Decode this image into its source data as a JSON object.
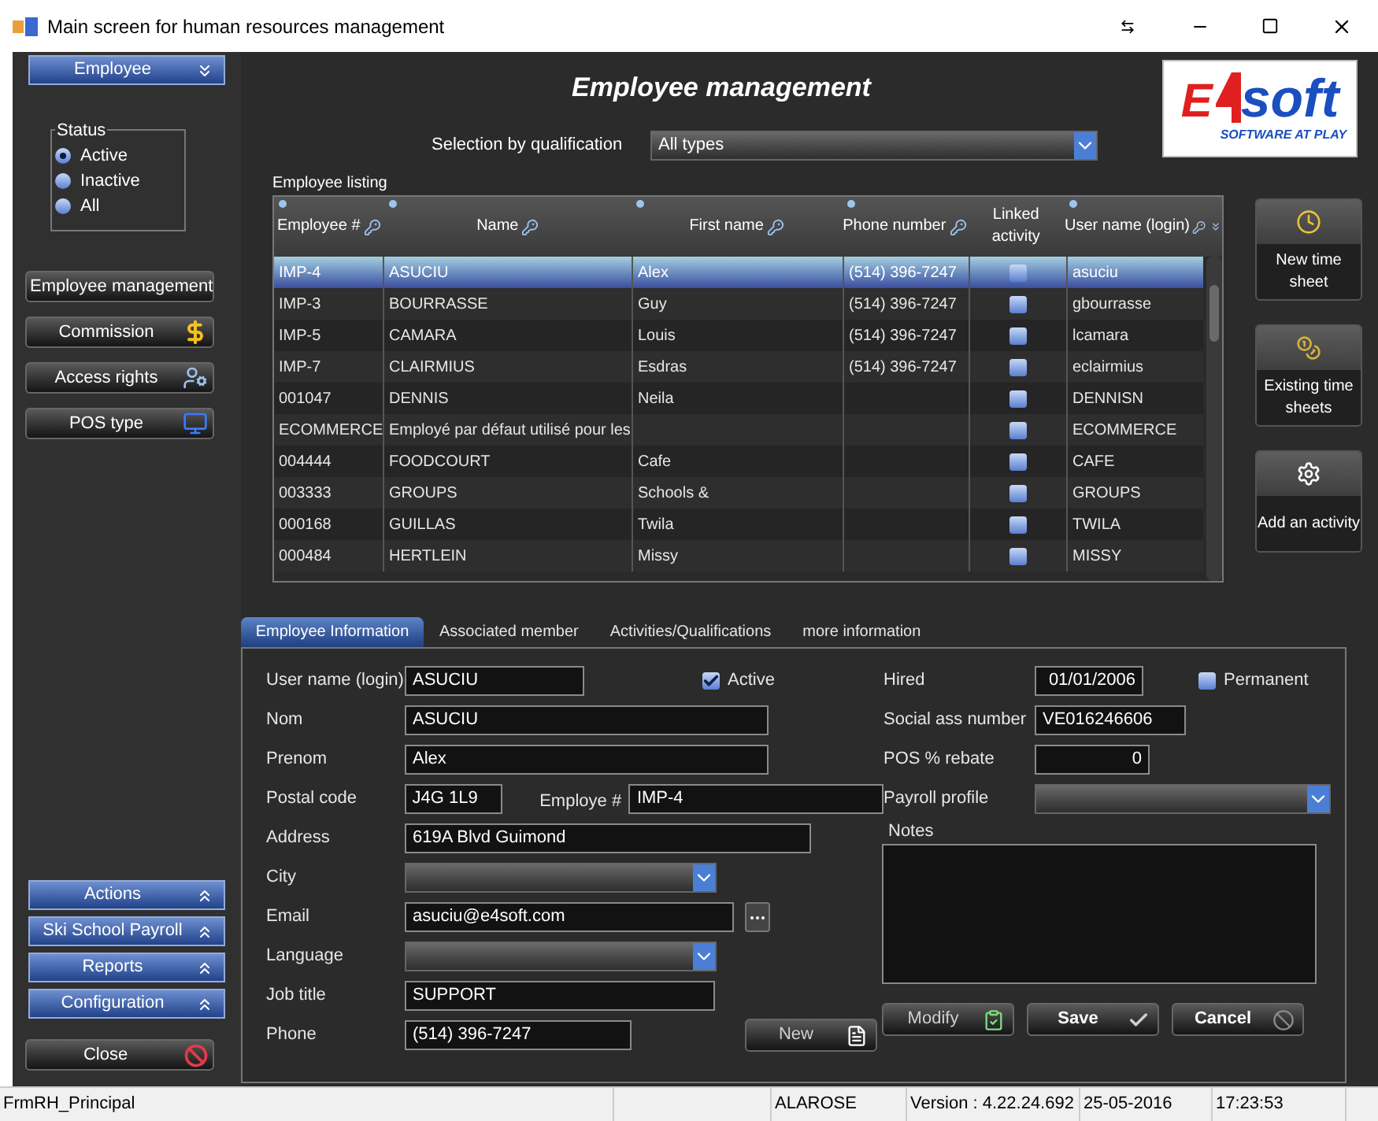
{
  "window": {
    "title": "Main screen for human resources management"
  },
  "sidebar": {
    "sections": [
      {
        "label": "Employee",
        "expanded": true
      },
      {
        "label": "Actions",
        "expanded": false
      },
      {
        "label": "Ski School Payroll",
        "expanded": false
      },
      {
        "label": "Reports",
        "expanded": false
      },
      {
        "label": "Configuration",
        "expanded": false
      }
    ],
    "status": {
      "label": "Status",
      "options": [
        {
          "label": "Active",
          "selected": true
        },
        {
          "label": "Inactive",
          "selected": false
        },
        {
          "label": "All",
          "selected": false
        }
      ]
    },
    "items": [
      {
        "label": "Employee management"
      },
      {
        "label": "Commission"
      },
      {
        "label": "Access rights"
      },
      {
        "label": "POS type"
      }
    ],
    "close_button": "Close"
  },
  "header": {
    "title": "Employee management",
    "logo": {
      "mark": "E",
      "name": "soft",
      "tagline": "SOFTWARE AT PLAY"
    }
  },
  "selection": {
    "label": "Selection by qualification",
    "value": "All types"
  },
  "listing": {
    "label": "Employee listing",
    "columns": [
      {
        "label": "Employee #",
        "filter": true
      },
      {
        "label": "Name",
        "filter": true
      },
      {
        "label": "First name",
        "filter": true
      },
      {
        "label": "Phone number",
        "filter": true
      },
      {
        "label": "Linked activity",
        "filter": false
      },
      {
        "label": "User name (login)",
        "filter": true
      }
    ],
    "rows": [
      {
        "cells": [
          "IMP-4",
          "ASUCIU",
          "Alex",
          "(514) 396-7247"
        ],
        "linked": false,
        "user": "asuciu",
        "selected": true
      },
      {
        "cells": [
          "IMP-3",
          "BOURRASSE",
          "Guy",
          "(514) 396-7247"
        ],
        "linked": false,
        "user": "gbourrasse",
        "selected": false
      },
      {
        "cells": [
          "IMP-5",
          "CAMARA",
          "Louis",
          "(514) 396-7247"
        ],
        "linked": false,
        "user": "lcamara",
        "selected": false
      },
      {
        "cells": [
          "IMP-7",
          "CLAIRMIUS",
          "Esdras",
          "(514) 396-7247"
        ],
        "linked": false,
        "user": "eclairmius",
        "selected": false
      },
      {
        "cells": [
          "001047",
          "DENNIS",
          "Neila",
          ""
        ],
        "linked": false,
        "user": "DENNISN",
        "selected": false
      },
      {
        "cells": [
          "ECOMMERCE",
          "Employé par défaut  utilisé pour les",
          "",
          ""
        ],
        "linked": false,
        "user": "ECOMMERCE",
        "selected": false
      },
      {
        "cells": [
          "004444",
          "FOODCOURT",
          "Cafe",
          ""
        ],
        "linked": false,
        "user": "CAFE",
        "selected": false
      },
      {
        "cells": [
          "003333",
          "GROUPS",
          "Schools &",
          ""
        ],
        "linked": false,
        "user": "GROUPS",
        "selected": false
      },
      {
        "cells": [
          "000168",
          "GUILLAS",
          "Twila",
          ""
        ],
        "linked": false,
        "user": "TWILA",
        "selected": false
      },
      {
        "cells": [
          "000484",
          "HERTLEIN",
          "Missy",
          ""
        ],
        "linked": false,
        "user": "MISSY",
        "selected": false
      }
    ]
  },
  "side_buttons": [
    {
      "label": "New time sheet"
    },
    {
      "label": "Existing time sheets"
    },
    {
      "label": "Add an activity"
    }
  ],
  "tabs": [
    {
      "label": "Employee Information",
      "selected": true
    },
    {
      "label": "Associated member",
      "selected": false
    },
    {
      "label": "Activities/Qualifications",
      "selected": false
    },
    {
      "label": "more information",
      "selected": false
    }
  ],
  "form": {
    "user_name": {
      "label": "User name (login)",
      "value": "ASUCIU"
    },
    "active": {
      "label": "Active",
      "checked": true
    },
    "nom": {
      "label": "Nom",
      "value": "ASUCIU"
    },
    "prenom": {
      "label": "Prenom",
      "value": "Alex"
    },
    "postal_code": {
      "label": "Postal code",
      "value": "J4G 1L9"
    },
    "employee_number": {
      "label": "Employe #",
      "value": "IMP-4"
    },
    "address": {
      "label": "Address",
      "value": "619A Blvd Guimond"
    },
    "city": {
      "label": "City"
    },
    "email": {
      "label": "Email",
      "value": "asuciu@e4soft.com"
    },
    "language": {
      "label": "Language"
    },
    "job_title": {
      "label": "Job title",
      "value": "SUPPORT"
    },
    "phone": {
      "label": "Phone",
      "value": "(514) 396-7247"
    },
    "hired": {
      "label": "Hired",
      "value": "01/01/2006"
    },
    "permanent": {
      "label": "Permanent",
      "checked": false
    },
    "social": {
      "label": "Social ass number",
      "value": "VE016246606"
    },
    "pos_rebate": {
      "label": "POS % rebate",
      "value": "0"
    },
    "payroll_profile": {
      "label": "Payroll profile"
    },
    "notes": {
      "label": "Notes"
    }
  },
  "buttons": [
    {
      "label": "New",
      "kind": "secondary"
    },
    {
      "label": "Modify",
      "kind": "secondary"
    },
    {
      "label": "Save",
      "kind": "primary"
    },
    {
      "label": "Cancel",
      "kind": "primary"
    }
  ],
  "status_bar": [
    "FrmRH_Principal",
    "ALAROSE",
    "Version : 4.22.24.692",
    "25-05-2016",
    "17:23:53"
  ]
}
